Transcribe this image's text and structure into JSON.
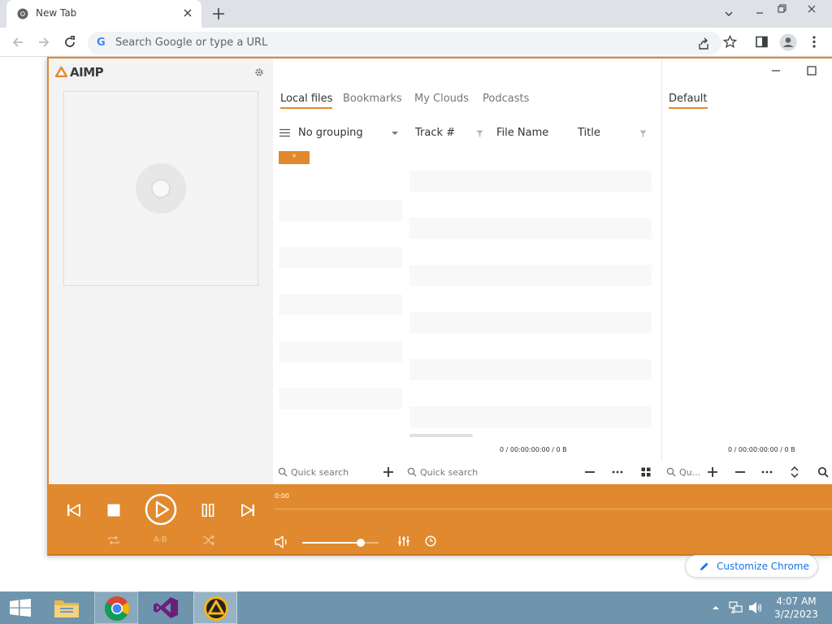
{
  "browser": {
    "tab_title": "New Tab",
    "omnibox_placeholder": "Search Google or type a URL",
    "google_letter": "G",
    "customize_label": "Customize Chrome"
  },
  "aimp": {
    "logo": "AIMP",
    "tabs": [
      "Local files",
      "Bookmarks",
      "My Clouds",
      "Podcasts"
    ],
    "right_tab": "Default",
    "columns": {
      "grouping": "No grouping",
      "track": "Track #",
      "file_name": "File Name",
      "title": "Title"
    },
    "group_button": "*",
    "status_left": "0 / 00:00:00:00 / 0 B",
    "status_right": "0 / 00:00:00:00 / 0 B",
    "quick_search_1": "Quick search",
    "quick_search_2": "Quick search",
    "quick_search_3": "Qu...",
    "time": "0:00",
    "ab_label": "A-B",
    "volume_level": 0.77
  },
  "taskbar": {
    "apps": [
      "file-explorer",
      "chrome",
      "visual-studio",
      "aimp"
    ],
    "clock_time": "4:07 AM",
    "clock_date": "3/2/2023"
  },
  "colors": {
    "accent": "#e0892e",
    "taskbar": "#6e95ad",
    "chrome_tabstrip": "#dee1e6",
    "link_blue": "#1a73e8"
  }
}
